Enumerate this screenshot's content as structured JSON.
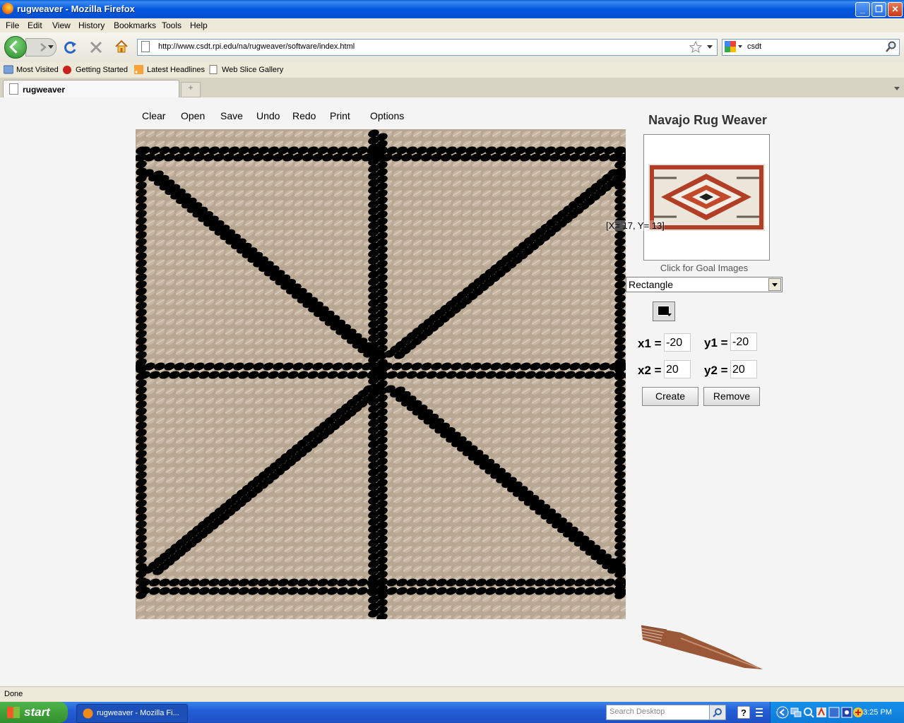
{
  "window": {
    "title": "rugweaver - Mozilla Firefox",
    "minimize_label": "_",
    "restore_label": "❐",
    "close_label": "✕"
  },
  "menubar": [
    "File",
    "Edit",
    "View",
    "History",
    "Bookmarks",
    "Tools",
    "Help"
  ],
  "navbar": {
    "url": "http://www.csdt.rpi.edu/na/rugweaver/software/index.html",
    "search_value": "csdt"
  },
  "bookmarks": [
    "Most Visited",
    "Getting Started",
    "Latest Headlines",
    "Web Slice Gallery"
  ],
  "tab": {
    "label": "rugweaver",
    "new_tab_symbol": "+"
  },
  "app": {
    "menu": [
      "Clear",
      "Open",
      "Save",
      "Undo",
      "Redo",
      "Print",
      "Options"
    ],
    "title": "Navajo Rug Weaver",
    "goal_caption": "Click for Goal Images",
    "coord_tooltip": "[X= 17, Y= 13]",
    "shape_select": "Rectangle",
    "color_swatch": "#000000",
    "fields": {
      "x1_label": "x1 =",
      "x1": "-20",
      "y1_label": "y1 =",
      "y1": "-20",
      "x2_label": "x2 =",
      "x2": "20",
      "y2_label": "y2 =",
      "y2": "20"
    },
    "create_label": "Create",
    "remove_label": "Remove",
    "weave_colors": {
      "background": "#b8a792",
      "thread": "#000000"
    }
  },
  "status": {
    "text": "Done"
  },
  "taskbar": {
    "start_label": "start",
    "task_label": "rugweaver - Mozilla Fi...",
    "desktop_search_placeholder": "Search Desktop",
    "clock": "3:25 PM"
  }
}
